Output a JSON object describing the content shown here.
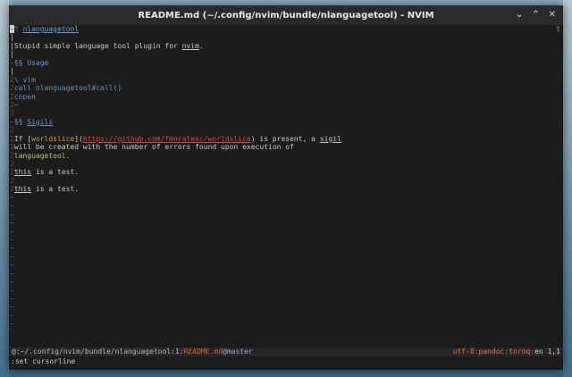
{
  "window": {
    "title": "README.md (~/.config/nvim/bundle/nlanguagetool) - NVIM",
    "minimize_glyph": "⌄",
    "maximize_glyph": "⌃",
    "close_glyph": "✕"
  },
  "editor": {
    "corner_flag": "t",
    "lines": {
      "l1_tag": "nlanguagetool",
      "l3_text": "Stupid simple language tool plugin for ",
      "l3_link": "nvim",
      "l3_end": ".",
      "l5_heading": "§§ Usage",
      "l7_text": "\\ vim",
      "l8_text": "call nlanguagetool#call()",
      "l9_text": "copen",
      "l10_text": "~",
      "l12_heading": "§§ ",
      "l12_link": "Sigils",
      "l14_pre": "If [",
      "l14_ref": "worldslice",
      "l14_mid": "](",
      "l14_url": "https://github.com/fmoralesc/worldslice",
      "l14_post": ") is present, a ",
      "l14_sigil": "sigil",
      "l15_text": "will be created with the number of errors found upon execution of",
      "l16_text": "languagetool",
      "l16_end": ".",
      "l18_this": "this",
      "l18_rest": " is a test.",
      "l20_this": "this",
      "l20_rest": " is a test."
    },
    "tilde": "~"
  },
  "statusline": {
    "path": "@:~/.config/nvim/bundle/nlanguagetool:1:",
    "file": "README.md",
    "branch": "@master",
    "encoding": "utf-8:pandoc:tnroq:",
    "lang": "en",
    "position": " 1,1"
  },
  "cmdline": {
    "text": ":set cursorline"
  }
}
